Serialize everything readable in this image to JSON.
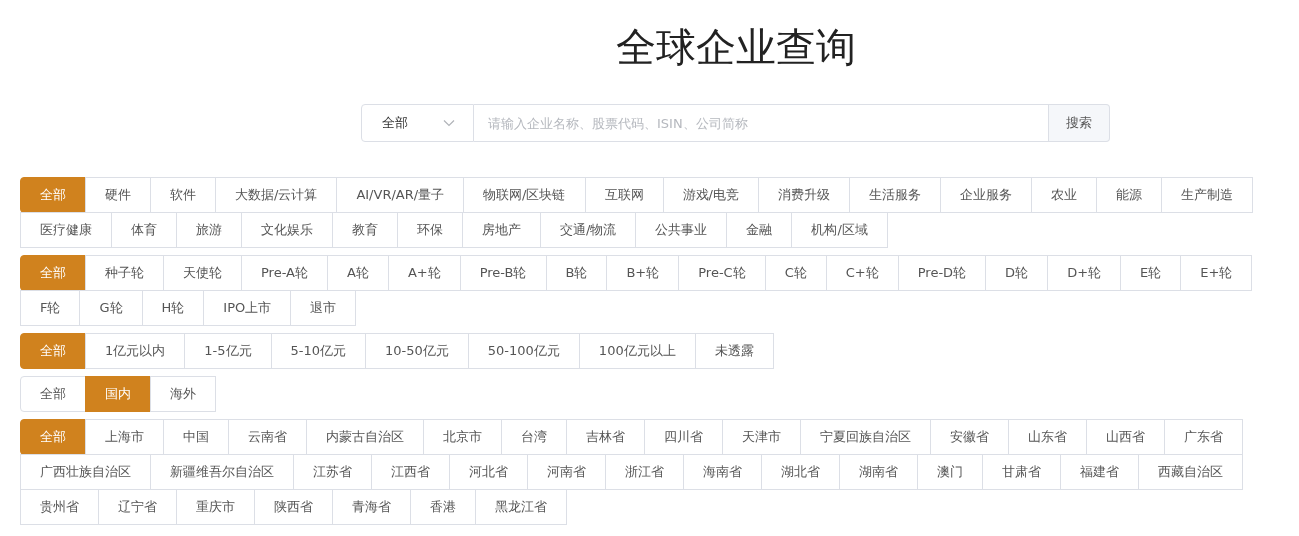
{
  "title": "全球企业查询",
  "search": {
    "scope": "全部",
    "placeholder": "请输入企业名称、股票代码、ISIN、公司简称",
    "button": "搜索"
  },
  "filter_groups": [
    {
      "options": [
        {
          "label": "全部",
          "selected": true
        },
        {
          "label": "硬件",
          "selected": false
        },
        {
          "label": "软件",
          "selected": false
        },
        {
          "label": "大数据/云计算",
          "selected": false
        },
        {
          "label": "AI/VR/AR/量子",
          "selected": false
        },
        {
          "label": "物联网/区块链",
          "selected": false
        },
        {
          "label": "互联网",
          "selected": false
        },
        {
          "label": "游戏/电竞",
          "selected": false
        },
        {
          "label": "消费升级",
          "selected": false
        },
        {
          "label": "生活服务",
          "selected": false
        },
        {
          "label": "企业服务",
          "selected": false
        },
        {
          "label": "农业",
          "selected": false
        },
        {
          "label": "能源",
          "selected": false
        },
        {
          "label": "生产制造",
          "selected": false
        },
        {
          "label": "医疗健康",
          "selected": false
        },
        {
          "label": "体育",
          "selected": false
        },
        {
          "label": "旅游",
          "selected": false
        },
        {
          "label": "文化娱乐",
          "selected": false
        },
        {
          "label": "教育",
          "selected": false
        },
        {
          "label": "环保",
          "selected": false
        },
        {
          "label": "房地产",
          "selected": false
        },
        {
          "label": "交通/物流",
          "selected": false
        },
        {
          "label": "公共事业",
          "selected": false
        },
        {
          "label": "金融",
          "selected": false
        },
        {
          "label": "机构/区域",
          "selected": false
        }
      ]
    },
    {
      "options": [
        {
          "label": "全部",
          "selected": true
        },
        {
          "label": "种子轮",
          "selected": false
        },
        {
          "label": "天使轮",
          "selected": false
        },
        {
          "label": "Pre-A轮",
          "selected": false
        },
        {
          "label": "A轮",
          "selected": false
        },
        {
          "label": "A+轮",
          "selected": false
        },
        {
          "label": "Pre-B轮",
          "selected": false
        },
        {
          "label": "B轮",
          "selected": false
        },
        {
          "label": "B+轮",
          "selected": false
        },
        {
          "label": "Pre-C轮",
          "selected": false
        },
        {
          "label": "C轮",
          "selected": false
        },
        {
          "label": "C+轮",
          "selected": false
        },
        {
          "label": "Pre-D轮",
          "selected": false
        },
        {
          "label": "D轮",
          "selected": false
        },
        {
          "label": "D+轮",
          "selected": false
        },
        {
          "label": "E轮",
          "selected": false
        },
        {
          "label": "E+轮",
          "selected": false
        },
        {
          "label": "F轮",
          "selected": false
        },
        {
          "label": "G轮",
          "selected": false
        },
        {
          "label": "H轮",
          "selected": false
        },
        {
          "label": "IPO上市",
          "selected": false
        },
        {
          "label": "退市",
          "selected": false
        }
      ]
    },
    {
      "options": [
        {
          "label": "全部",
          "selected": true
        },
        {
          "label": "1亿元以内",
          "selected": false
        },
        {
          "label": "1-5亿元",
          "selected": false
        },
        {
          "label": "5-10亿元",
          "selected": false
        },
        {
          "label": "10-50亿元",
          "selected": false
        },
        {
          "label": "50-100亿元",
          "selected": false
        },
        {
          "label": "100亿元以上",
          "selected": false
        },
        {
          "label": "未透露",
          "selected": false
        }
      ]
    },
    {
      "options": [
        {
          "label": "全部",
          "selected": false
        },
        {
          "label": "国内",
          "selected": true
        },
        {
          "label": "海外",
          "selected": false
        }
      ]
    },
    {
      "options": [
        {
          "label": "全部",
          "selected": true
        },
        {
          "label": "上海市",
          "selected": false
        },
        {
          "label": "中国",
          "selected": false
        },
        {
          "label": "云南省",
          "selected": false
        },
        {
          "label": "内蒙古自治区",
          "selected": false
        },
        {
          "label": "北京市",
          "selected": false
        },
        {
          "label": "台湾",
          "selected": false
        },
        {
          "label": "吉林省",
          "selected": false
        },
        {
          "label": "四川省",
          "selected": false
        },
        {
          "label": "天津市",
          "selected": false
        },
        {
          "label": "宁夏回族自治区",
          "selected": false
        },
        {
          "label": "安徽省",
          "selected": false
        },
        {
          "label": "山东省",
          "selected": false
        },
        {
          "label": "山西省",
          "selected": false
        },
        {
          "label": "广东省",
          "selected": false
        },
        {
          "label": "广西壮族自治区",
          "selected": false
        },
        {
          "label": "新疆维吾尔自治区",
          "selected": false
        },
        {
          "label": "江苏省",
          "selected": false
        },
        {
          "label": "江西省",
          "selected": false
        },
        {
          "label": "河北省",
          "selected": false
        },
        {
          "label": "河南省",
          "selected": false
        },
        {
          "label": "浙江省",
          "selected": false
        },
        {
          "label": "海南省",
          "selected": false
        },
        {
          "label": "湖北省",
          "selected": false
        },
        {
          "label": "湖南省",
          "selected": false
        },
        {
          "label": "澳门",
          "selected": false
        },
        {
          "label": "甘肃省",
          "selected": false
        },
        {
          "label": "福建省",
          "selected": false
        },
        {
          "label": "西藏自治区",
          "selected": false
        },
        {
          "label": "贵州省",
          "selected": false
        },
        {
          "label": "辽宁省",
          "selected": false
        },
        {
          "label": "重庆市",
          "selected": false
        },
        {
          "label": "陕西省",
          "selected": false
        },
        {
          "label": "青海省",
          "selected": false
        },
        {
          "label": "香港",
          "selected": false
        },
        {
          "label": "黑龙江省",
          "selected": false
        }
      ]
    }
  ]
}
